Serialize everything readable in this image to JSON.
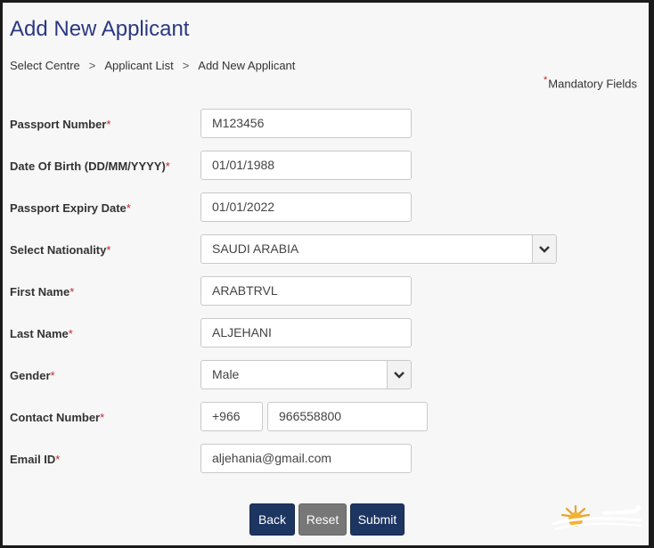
{
  "page": {
    "title": "Add New Applicant",
    "mandatory_marker": "*",
    "mandatory_text": "Mandatory Fields"
  },
  "breadcrumb": [
    {
      "label": "Select Centre",
      "separator": ">"
    },
    {
      "label": "Applicant List",
      "separator": ">"
    },
    {
      "label": "Add New Applicant"
    }
  ],
  "form": {
    "required_marker": "*",
    "passport_number": {
      "label": "Passport Number",
      "value": "M123456"
    },
    "date_of_birth": {
      "label": "Date Of Birth (DD/MM/YYYY)",
      "value": "01/01/1988"
    },
    "passport_expiry": {
      "label": "Passport Expiry Date",
      "value": "01/01/2022"
    },
    "nationality": {
      "label": "Select Nationality",
      "value": "SAUDI ARABIA"
    },
    "first_name": {
      "label": "First Name",
      "value": "ARABTRVL"
    },
    "last_name": {
      "label": "Last Name",
      "value": "ALJEHANI"
    },
    "gender": {
      "label": "Gender",
      "value": "Male"
    },
    "contact": {
      "label": "Contact Number",
      "country_code": "+966",
      "number": "966558800"
    },
    "email": {
      "label": "Email ID",
      "value": "aljehania@gmail.com"
    }
  },
  "buttons": {
    "back": "Back",
    "reset": "Reset",
    "submit": "Submit"
  },
  "colors": {
    "title": "#2a3883",
    "required": "#c0282d",
    "button_primary": "#1d3561",
    "button_reset": "#777777"
  },
  "icons": {
    "select_arrow": "chevron-down-icon",
    "watermark": "sun-logo-icon"
  }
}
